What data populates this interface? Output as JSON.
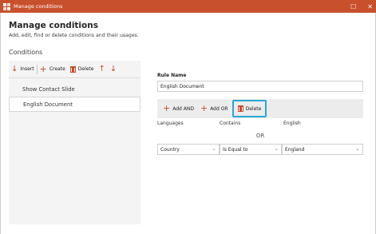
{
  "titlebar": {
    "title": "Manage conditions",
    "maximize": "☐",
    "close": "✕",
    "accent": "#c9502d"
  },
  "header": {
    "title": "Manage conditions",
    "description": "Add, edit, find or delete conditions and their usages."
  },
  "section_label": "Conditions",
  "toolbar": {
    "insert": "Insert",
    "create": "Create",
    "delete": "Delete",
    "up": "↑",
    "down": "↓"
  },
  "list": {
    "items": [
      {
        "label": "Show Contact Slide",
        "selected": false
      },
      {
        "label": "English Document",
        "selected": true
      }
    ]
  },
  "rule": {
    "label": "Rule Name",
    "value": "English Document"
  },
  "conditions_toolbar": {
    "add_and": "Add AND",
    "add_or": "Add OR",
    "delete": "Delete",
    "highlight_color": "#29a8d4"
  },
  "condition_1": {
    "field": "Languages",
    "operator": "Contains",
    "value": "English"
  },
  "or_label": "OR",
  "condition_2": {
    "field": "Country",
    "operator": "Is Equal to",
    "value": "England"
  }
}
